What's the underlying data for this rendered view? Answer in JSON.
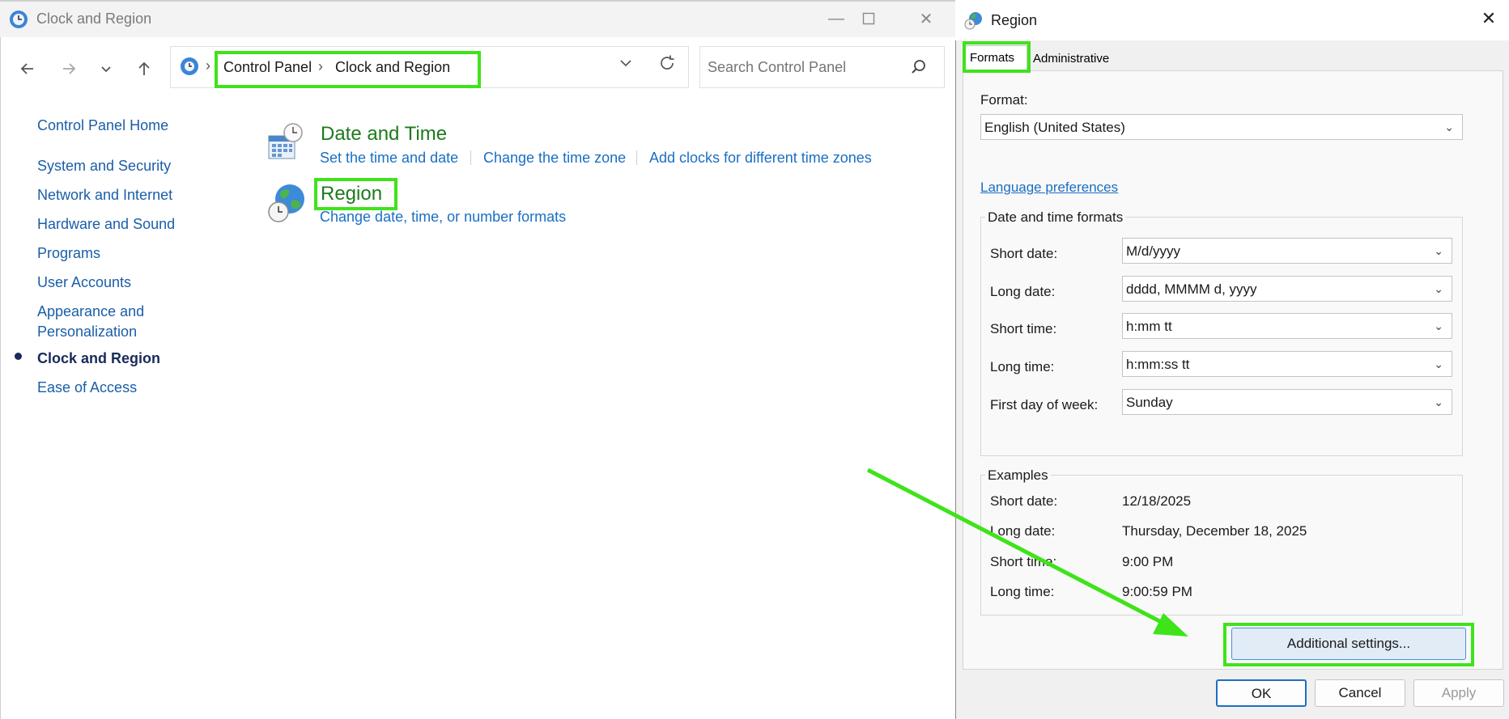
{
  "cp_window": {
    "title": "Clock and Region",
    "search_placeholder": "Search Control Panel",
    "breadcrumb": {
      "root": "Control Panel",
      "separator": "›",
      "current": "Clock and Region",
      "lead_separator": "›"
    },
    "nav": {
      "home": "Control Panel Home",
      "items": [
        {
          "label": "System and Security"
        },
        {
          "label": "Network and Internet"
        },
        {
          "label": "Hardware and Sound"
        },
        {
          "label": "Programs"
        },
        {
          "label": "User Accounts"
        },
        {
          "label": "Appearance and"
        },
        {
          "label": "Personalization"
        },
        {
          "label": "Clock and Region"
        },
        {
          "label": "Ease of Access"
        }
      ]
    },
    "categories": {
      "date_time": {
        "title": "Date and Time",
        "links": [
          "Set the time and date",
          "Change the time zone",
          "Add clocks for different time zones"
        ]
      },
      "region": {
        "title": "Region",
        "link": "Change date, time, or number formats"
      }
    }
  },
  "region_dialog": {
    "title": "Region",
    "tabs": [
      "Formats",
      "Administrative"
    ],
    "format_label": "Format:",
    "format_value": "English (United States)",
    "language_link": "Language preferences",
    "dt_group_title": "Date and time formats",
    "dt_rows": [
      {
        "label": "Short date:",
        "value": "M/d/yyyy"
      },
      {
        "label": "Long date:",
        "value": "dddd, MMMM d, yyyy"
      },
      {
        "label": "Short time:",
        "value": "h:mm tt"
      },
      {
        "label": "Long time:",
        "value": "h:mm:ss tt"
      },
      {
        "label": "First day of week:",
        "value": "Sunday"
      }
    ],
    "examples_title": "Examples",
    "examples": [
      {
        "label": "Short date:",
        "value": "12/18/2025"
      },
      {
        "label": "Long date:",
        "value": "Thursday, December 18, 2025"
      },
      {
        "label": "Short time:",
        "value": "9:00 PM"
      },
      {
        "label": "Long time:",
        "value": "9:00:59 PM"
      }
    ],
    "additional_settings": "Additional settings...",
    "buttons": {
      "ok": "OK",
      "cancel": "Cancel",
      "apply": "Apply"
    }
  },
  "colors": {
    "highlight": "#3fe31a",
    "link": "#1a6fc4",
    "category_title": "#1d7a1d",
    "selected_nav": "#1a2a5a"
  },
  "icons": {
    "minimize": "minimize-icon",
    "maximize": "maximize-icon",
    "close": "close-icon",
    "back": "back-arrow-icon",
    "forward": "forward-arrow-icon",
    "recent": "chevron-down-icon",
    "up": "up-arrow-icon",
    "refresh": "refresh-icon",
    "search": "search-icon"
  }
}
